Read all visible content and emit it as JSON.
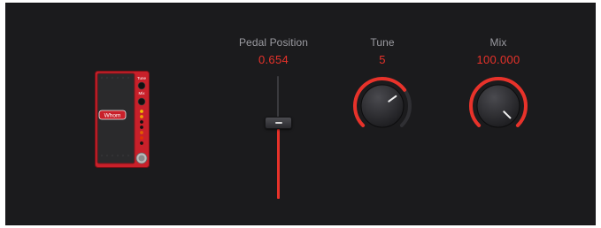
{
  "pedal": {
    "name": "Whammy pedal",
    "badge_text": "Whom",
    "tune_label": "Tune",
    "mix_label": "Mix",
    "body_color": "#c8202a"
  },
  "controls": {
    "pedal_position": {
      "label": "Pedal Position",
      "value": "0.654",
      "level": 0.654
    },
    "tune": {
      "label": "Tune",
      "value": "5",
      "level": 0.7
    },
    "mix": {
      "label": "Mix",
      "value": "100.000",
      "level": 1.0
    }
  },
  "colors": {
    "panel_background": "#1b1b1d",
    "label": "#9a9aa0",
    "accent": "#e8322a"
  }
}
